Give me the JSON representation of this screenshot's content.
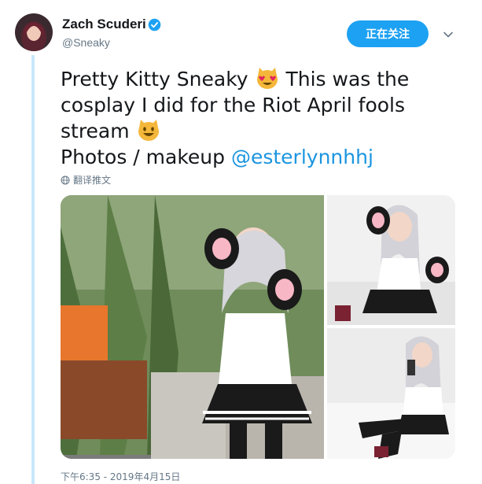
{
  "user": {
    "display_name": "Zach Scuderi",
    "handle": "@Sneaky",
    "verified": true
  },
  "actions": {
    "follow_label": "正在关注",
    "menu_icon": "chevron-down-icon"
  },
  "tweet": {
    "line1_before": "Pretty Kitty Sneaky ",
    "line1_after": " This was the",
    "line2": "cosplay I did for the Riot April fools",
    "line3": "stream ",
    "line4_text": "Photos / makeup ",
    "mention": "@esterlynnhhj",
    "emoji_1": "heart-eyes-cat-emoji",
    "emoji_2": "smiling-cat-emoji"
  },
  "translate_label": "翻译推文",
  "timestamp": "下午6:35 - 2019年4月15日",
  "colors": {
    "accent": "#1da1f2",
    "mention": "#1b95e0",
    "secondary_text": "#657786",
    "thread_line": "#c8e6fb"
  },
  "media": [
    {
      "name": "cosplay-photo-main",
      "depicts": "photo"
    },
    {
      "name": "cosplay-photo-top-right",
      "depicts": "photo"
    },
    {
      "name": "cosplay-photo-bottom-right",
      "depicts": "photo"
    }
  ]
}
